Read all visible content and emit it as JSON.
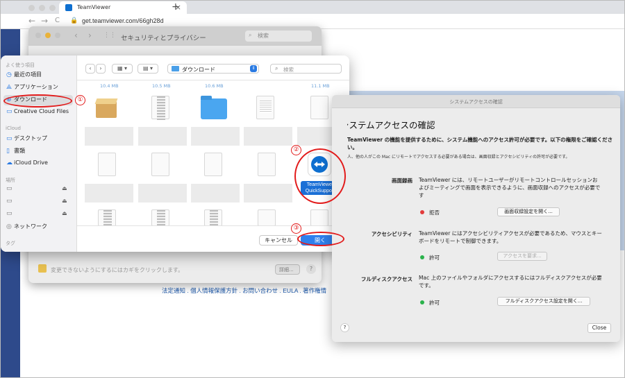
{
  "browser": {
    "tab_title": "TeamViewer",
    "tab_close": "×",
    "new_tab": "+",
    "back": "←",
    "forward": "→",
    "reload": "C",
    "url": "get.teamviewer.com/66gh28d"
  },
  "page": {
    "footer_links": "法定通知 . 個人情報保護方針 . お問い合わせ . EULA . 著作権情"
  },
  "prefs": {
    "title": "セキュリティとプライバシー",
    "search_placeholder": "検索",
    "hint": "変更できないようにするにはカギをクリックします。",
    "details_button": "詳細...",
    "help": "?"
  },
  "file_dialog": {
    "sidebar": {
      "favorites_header": "よく使う項目",
      "favorites": [
        {
          "label": "最近の項目",
          "icon": "clock-icon"
        },
        {
          "label": "アプリケーション",
          "icon": "apps-icon"
        },
        {
          "label": "ダウンロード",
          "icon": "download-icon"
        },
        {
          "label": "Creative Cloud Files",
          "icon": "folder-icon"
        }
      ],
      "icloud_header": "iCloud",
      "icloud": [
        {
          "label": "デスクトップ",
          "icon": "desktop-icon"
        },
        {
          "label": "書類",
          "icon": "document-icon"
        },
        {
          "label": "iCloud Drive",
          "icon": "cloud-icon"
        }
      ],
      "locations_header": "場所",
      "network": "ネットワーク",
      "tags_header": "タグ"
    },
    "toolbar": {
      "back": "‹",
      "forward": "›",
      "view_icon": "▦ ▾",
      "group_icon": "▤ ▾",
      "location": "ダウンロード",
      "search_placeholder": "検索"
    },
    "file_sizes": [
      "10.4 MB",
      "10.5 MB",
      "10.6 MB",
      "11.1 MB"
    ],
    "selected_file": "TeamViewer QuickSupport",
    "cancel": "キャンセル",
    "open": "開く"
  },
  "system_access": {
    "window_title": "システムアクセスの確認",
    "heading": "システムアクセスの確認",
    "intro": "TeamViewer の機能を提供するために、システム機能へのアクセス許可が必要です。以下の権限をご確認ください。",
    "note": "人、他の人がこの Mac にリモートでアクセスする必要がある場合は、画面収録とアクセシビリティの許可が必要です。",
    "rows": [
      {
        "label": "画面録画",
        "desc": "TeamViewer には、リモートユーザーがリモートコントロールセッションおよびミーティングで画面を表示できるように、画面収録へのアクセスが必要です",
        "status": "拒否",
        "status_color": "#e23b3b",
        "button": "画面収録設定を開く..."
      },
      {
        "label": "アクセシビリティ",
        "desc": "TeamViewer にはアクセシビリティアクセスが必要であるため、マウスとキーボードをリモートで制御できます。",
        "status": "許可",
        "status_color": "#2bb24c",
        "button": "アクセスを要求..."
      },
      {
        "label": "フルディスクアクセス",
        "desc": "Mac 上のファイルやフォルダにアクセスするにはフルディスクアクセスが必要です。",
        "status": "許可",
        "status_color": "#2bb24c",
        "button": "フルディスクアクセス設定を開く..."
      }
    ],
    "help": "?",
    "close": "Close"
  },
  "annotations": [
    "①",
    "②",
    "③"
  ],
  "colors": {
    "accent": "#2f80ed",
    "annotation": "#e21b1b",
    "teamviewer_blue": "#0e6fd0"
  }
}
